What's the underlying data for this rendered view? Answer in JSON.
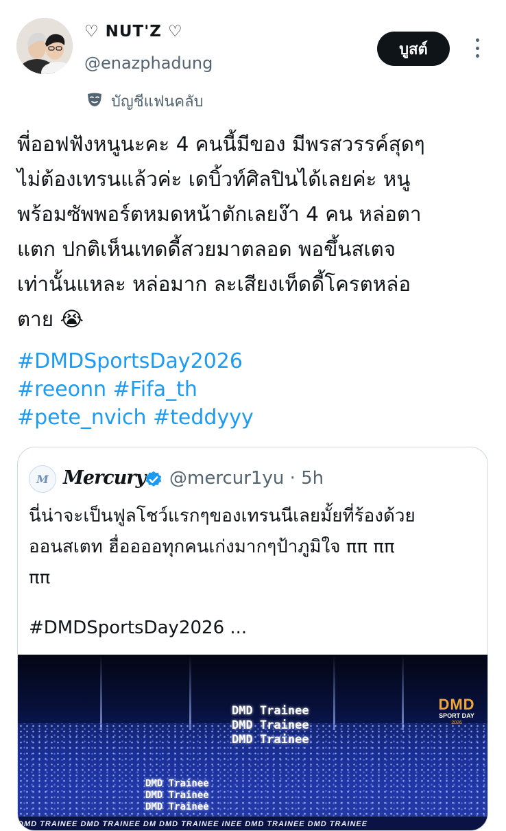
{
  "user": {
    "display_name": "♡ NUT'Z ♡",
    "handle": "@enazphadung",
    "fanclub_label": "บัญชีแฟนคลับ",
    "fanclub_icon": "mask-icon"
  },
  "actions": {
    "subscribe_label": "บูสต์",
    "more_icon": "more-vertical-icon"
  },
  "tweet": {
    "lines": [
      "พี่ออฟฟังหนูนะคะ 4 คนนี้มีของ มีพรสวรรค์สุดๆ",
      "ไม่ต้องเทรนแล้วค่ะ เดบิ้วท์ศิลปินได้เลยค่ะ หนู",
      "พร้อมซัพพอร์ตหมดหน้าตักเลยง๊า 4 คน หล่อตา",
      "แตก ปกติเห็นเทดดี้สวยมาตลอด พอขึ้นสเตจ",
      "เท่านั้นแหละ หล่อมาก ละเสียงเท็ดดี้โครตหล่อ",
      "ตาย 😭"
    ],
    "hashtag_lines": [
      "#DMDSportsDay2026",
      "#reeonn #Fifa_th",
      "#pete_nvich #teddyyy"
    ]
  },
  "quote": {
    "avatar_label": "M",
    "name": "Mercury",
    "verified_icon": "verified-badge-icon",
    "handle": "@mercur1yu",
    "separator": "·",
    "time": "5h",
    "text_lines": [
      "นี่น่าจะเป็นฟูลโชว์แรกๆของเทรนนีเลยมั้ยที่ร้องด้วย",
      "ออนสเตท ฮื่ออออทุกคนเก่งมากๆป้าภูมิใจ ππ ππ",
      "ππ"
    ],
    "hashtag": "#DMDSportsDay2026 ...",
    "image": {
      "screen_text_center": [
        "DMD Trainee",
        "DMD Trainee",
        "DMD Trainee"
      ],
      "screen_text_left": [
        "DMD Trainee",
        "DMD Trainee",
        "DMD Trainee"
      ],
      "badge_big": "DMD",
      "badge_small": "SPORT DAY",
      "badge_year": "2026",
      "ticker": "DMD TRAINEE      DMD TRAINEE    DM      DMD TRAINEE     INEE  DMD TRAINEE  DMD TRAINEE"
    }
  },
  "colors": {
    "link": "#1d9bf0",
    "muted": "#536471",
    "verified": "#1d9bf0"
  }
}
